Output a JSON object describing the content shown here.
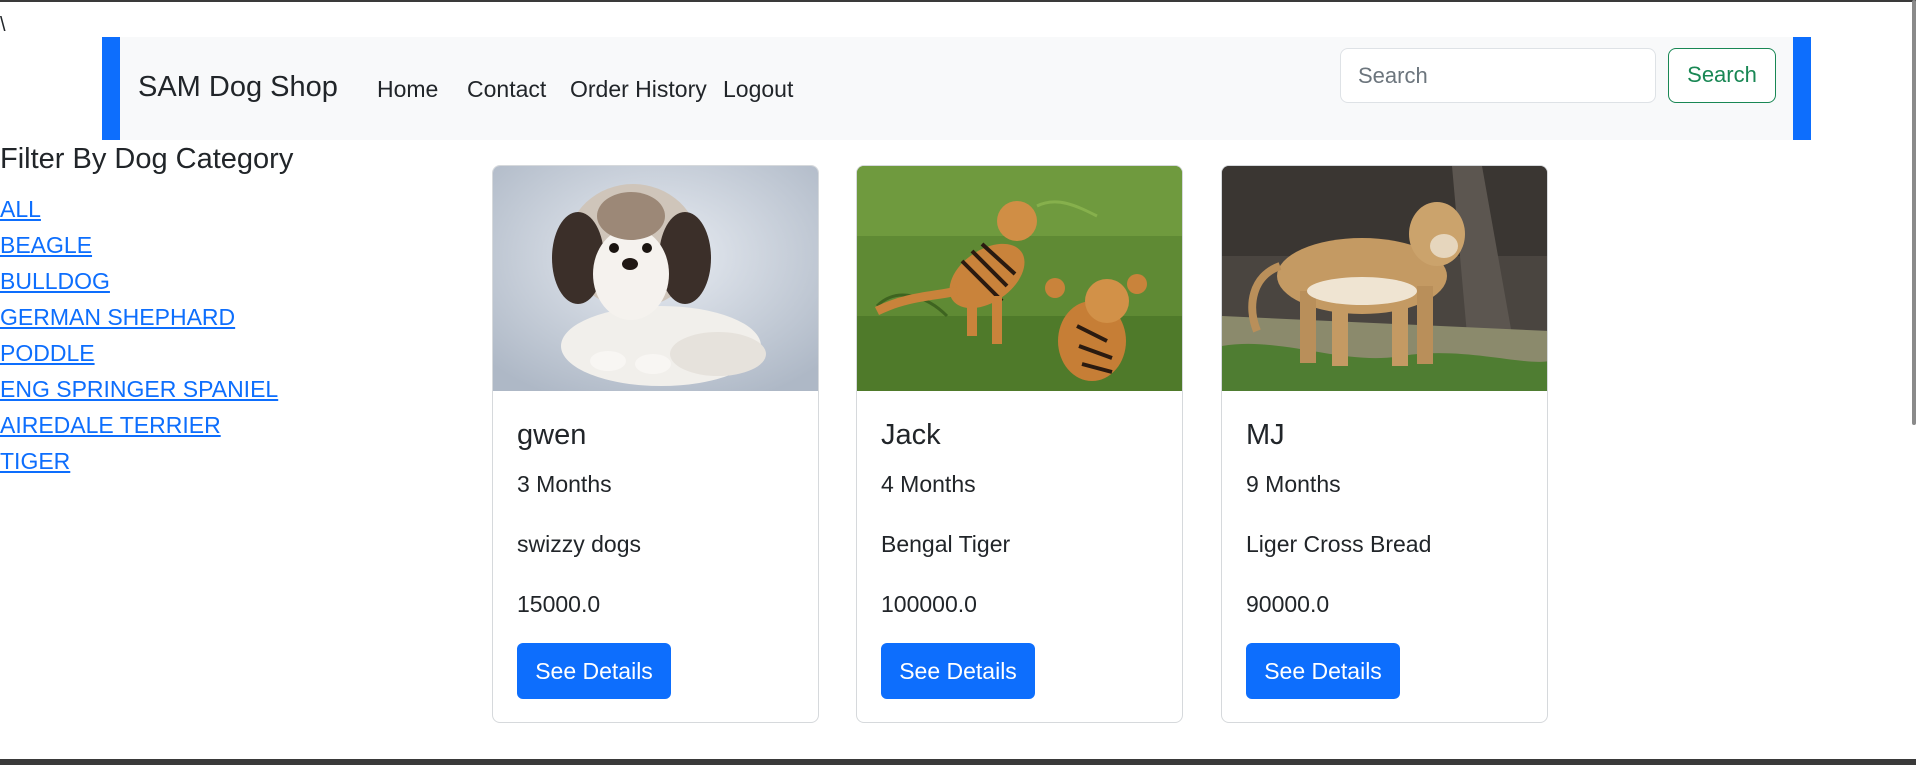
{
  "stray_text": "\\",
  "navbar": {
    "brand": "SAM Dog Shop",
    "links": [
      "Home",
      "Contact",
      "Order History",
      "Logout"
    ],
    "search_placeholder": "Search",
    "search_button": "Search"
  },
  "sidebar": {
    "title": "Filter By Dog Category",
    "categories": [
      "ALL",
      "BEAGLE",
      "BULLDOG",
      "GERMAN SHEPHARD",
      "PODDLE",
      "ENG SPRINGER SPANIEL",
      "AIREDALE TERRIER",
      "TIGER"
    ]
  },
  "products": [
    {
      "name": "gwen",
      "age": "3 Months",
      "description": "swizzy dogs",
      "price": "15000.0",
      "button": "See Details",
      "image": "shih-tzu-dog-photo"
    },
    {
      "name": "Jack",
      "age": "4 Months",
      "description": "Bengal Tiger",
      "price": "100000.0",
      "button": "See Details",
      "image": "tiger-cubs-photo"
    },
    {
      "name": "MJ",
      "age": "9 Months",
      "description": "Liger Cross Bread",
      "price": "90000.0",
      "button": "See Details",
      "image": "liger-photo"
    }
  ],
  "colors": {
    "primary": "#0d6efd",
    "success": "#198754",
    "navbar_bg": "#f8f9fa"
  }
}
